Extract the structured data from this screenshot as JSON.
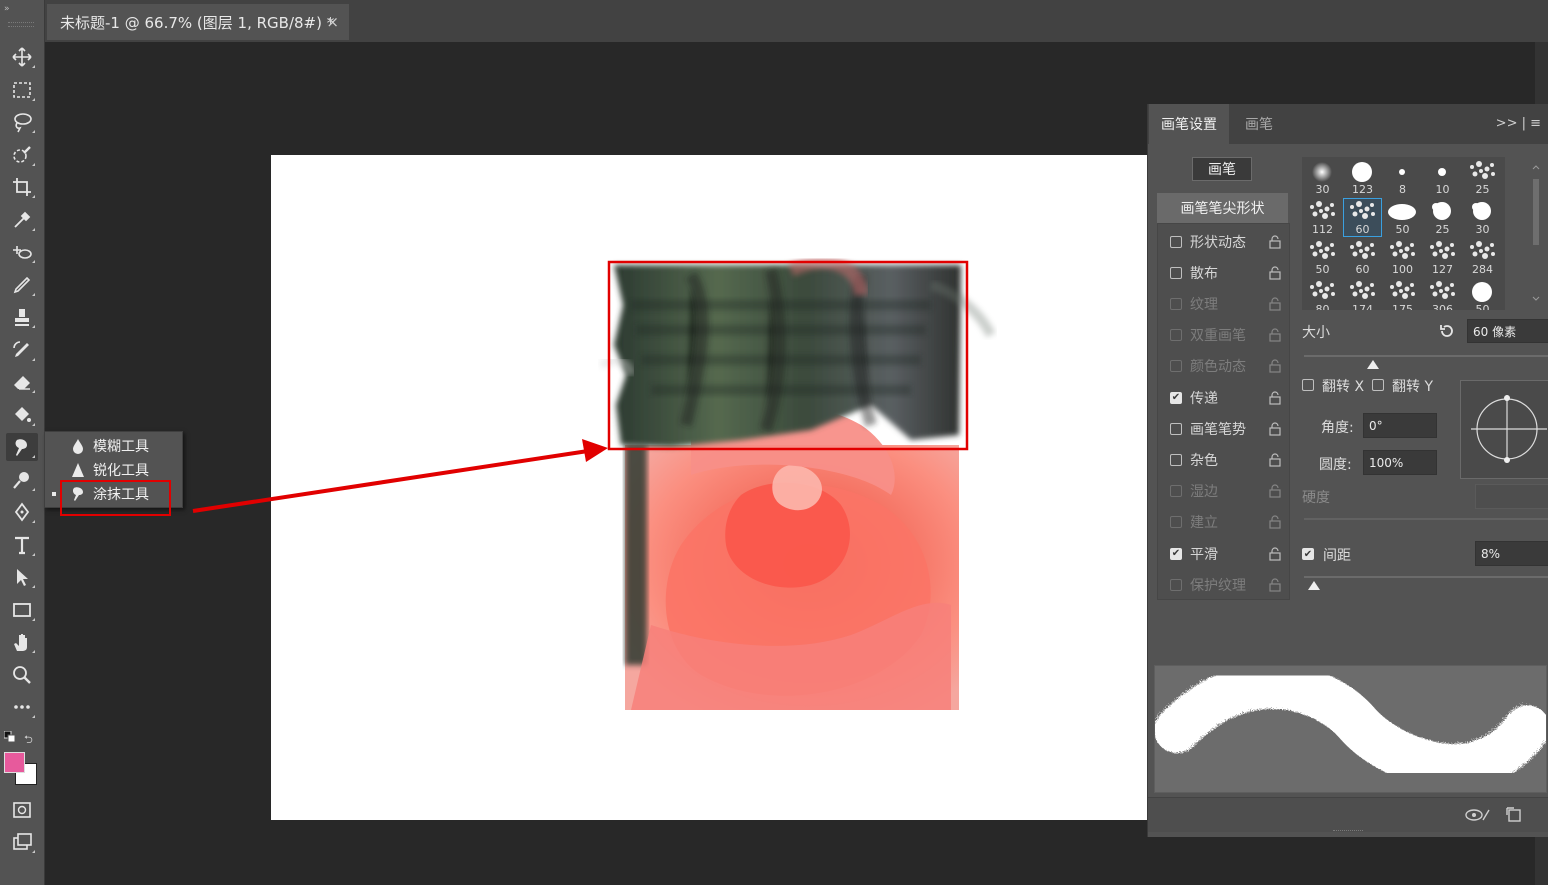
{
  "document": {
    "tab_title": "未标题-1 @ 66.7% (图层 1, RGB/8#) *",
    "close_symbol": "×"
  },
  "toolbar": {
    "collapse_symbol": "»",
    "colors": {
      "foreground": "#e75a9c",
      "background": "#ffffff"
    },
    "tools": [
      "move-tool",
      "marquee-tool",
      "lasso-tool",
      "quick-select-tool",
      "crop-tool",
      "eyedropper-tool",
      "healing-brush-tool",
      "brush-tool",
      "clone-stamp-tool",
      "history-brush-tool",
      "eraser-tool",
      "paint-bucket-tool",
      "smudge-tool",
      "dodge-tool",
      "pen-tool",
      "type-tool",
      "path-select-tool",
      "rectangle-tool",
      "hand-tool",
      "zoom-tool",
      "edit-toolbar"
    ]
  },
  "flyout": {
    "items": [
      {
        "label": "模糊工具",
        "icon": "blur-drop-icon",
        "active": false
      },
      {
        "label": "锐化工具",
        "icon": "sharpen-triangle-icon",
        "active": false
      },
      {
        "label": "涂抹工具",
        "icon": "smudge-finger-icon",
        "active": true
      }
    ]
  },
  "annotations": {
    "highlight_color": "#e10000"
  },
  "brush_panel": {
    "tabs": [
      "画笔设置",
      "画笔"
    ],
    "menu_symbols": ">>  |  ≡",
    "brushes_button": "画笔",
    "tip_shape": "画笔笔尖形状",
    "options": [
      {
        "label": "形状动态",
        "checked": false,
        "enabled": true
      },
      {
        "label": "散布",
        "checked": false,
        "enabled": true
      },
      {
        "label": "纹理",
        "checked": false,
        "enabled": false
      },
      {
        "label": "双重画笔",
        "checked": false,
        "enabled": false
      },
      {
        "label": "颜色动态",
        "checked": false,
        "enabled": false
      },
      {
        "label": "传递",
        "checked": true,
        "enabled": true
      },
      {
        "label": "画笔笔势",
        "checked": false,
        "enabled": true
      },
      {
        "label": "杂色",
        "checked": false,
        "enabled": true
      },
      {
        "label": "湿边",
        "checked": false,
        "enabled": false
      },
      {
        "label": "建立",
        "checked": false,
        "enabled": false
      },
      {
        "label": "平滑",
        "checked": true,
        "enabled": true
      },
      {
        "label": "保护纹理",
        "checked": false,
        "enabled": false
      }
    ],
    "presets": [
      "30",
      "123",
      "8",
      "10",
      "25",
      "112",
      "60",
      "50",
      "25",
      "30",
      "50",
      "60",
      "100",
      "127",
      "284",
      "80",
      "174",
      "175",
      "306",
      "50"
    ],
    "selected_preset": 6,
    "size_label": "大小",
    "size_value": "60 像素",
    "size_fraction": 0.28,
    "flip_x": "翻转 X",
    "flip_y": "翻转 Y",
    "angle_label": "角度:",
    "angle_value": "0°",
    "roundness_label": "圆度:",
    "roundness_value": "100%",
    "hardness_label": "硬度",
    "spacing_label": "间距",
    "spacing_checked": true,
    "spacing_value": "8%",
    "spacing_fraction": 0.04
  }
}
